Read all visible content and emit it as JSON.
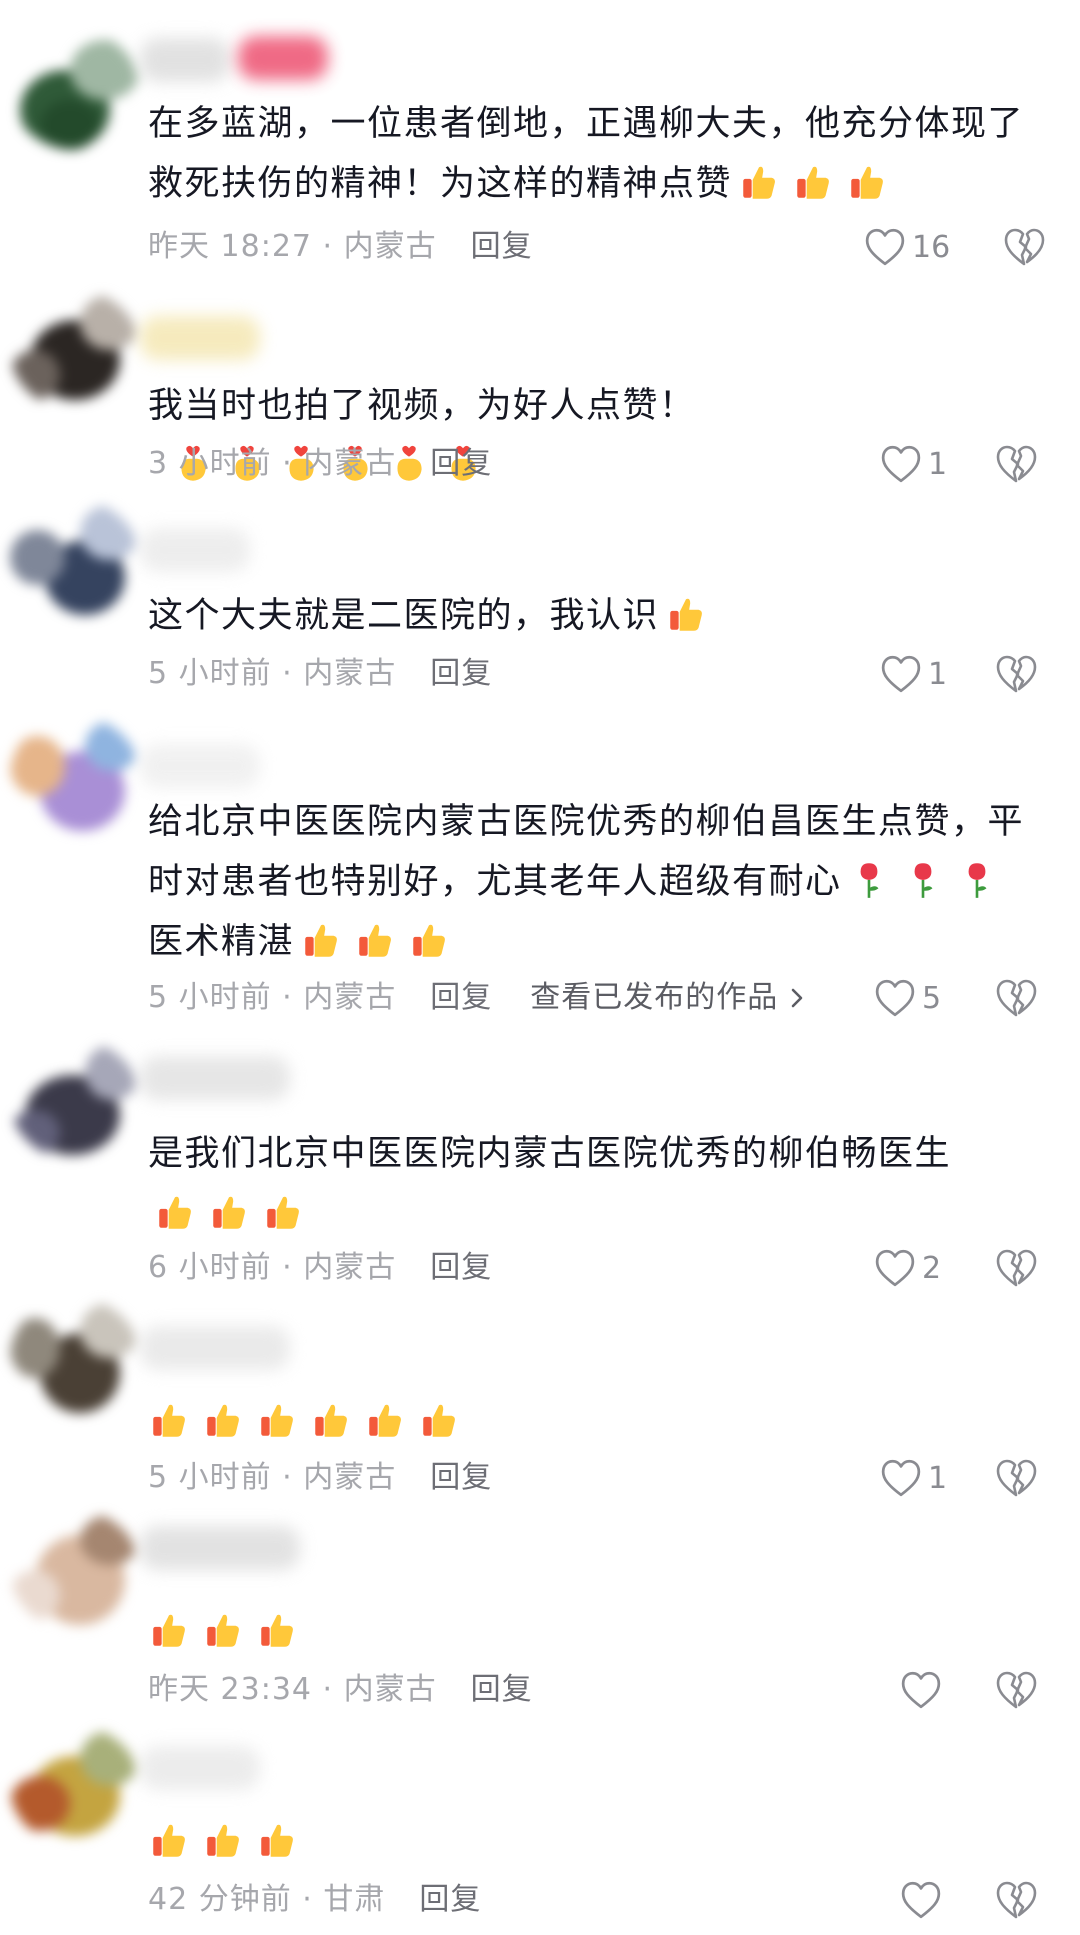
{
  "comments": [
    {
      "text": "在多蓝湖，一位患者倒地，正遇柳大夫，他充分体现了救死扶伤的精神！为这样的精神点赞",
      "emoji": [
        "thumbs-up-icon",
        "thumbs-up-icon",
        "thumbs-up-icon"
      ],
      "time": "昨天 18:27 · 内蒙古",
      "reply": "回复",
      "likes": "16"
    },
    {
      "text": "我当时也拍了视频，为好人点赞！",
      "emoji": [
        "finger-heart-icon",
        "finger-heart-icon",
        "finger-heart-icon",
        "finger-heart-icon",
        "finger-heart-icon",
        "finger-heart-icon"
      ],
      "time": "3 小时前 · 内蒙古",
      "reply": "回复",
      "likes": "1"
    },
    {
      "text": "这个大夫就是二医院的，我认识",
      "emoji": [
        "thumbs-up-icon"
      ],
      "time": "5 小时前 · 内蒙古",
      "reply": "回复",
      "likes": "1"
    },
    {
      "text_a": "给北京中医医院内蒙古医院优秀的柳伯昌医生点赞，平时对患者也特别好，尤其老年人超级有耐心",
      "emoji_a": [
        "rose-icon",
        "rose-icon",
        "rose-icon"
      ],
      "text_b": "医术精湛",
      "emoji_b": [
        "thumbs-up-icon",
        "thumbs-up-icon",
        "thumbs-up-icon"
      ],
      "time": "5 小时前 · 内蒙古",
      "reply": "回复",
      "works_link": "查看已发布的作品",
      "likes": "5"
    },
    {
      "text": "是我们北京中医医院内蒙古医院优秀的柳伯畅医生",
      "emoji": [
        "thumbs-up-icon",
        "thumbs-up-icon",
        "thumbs-up-icon"
      ],
      "time": "6 小时前 · 内蒙古",
      "reply": "回复",
      "likes": "2"
    },
    {
      "emoji": [
        "thumbs-up-icon",
        "thumbs-up-icon",
        "thumbs-up-icon",
        "thumbs-up-icon",
        "thumbs-up-icon",
        "thumbs-up-icon"
      ],
      "time": "5 小时前 · 内蒙古",
      "reply": "回复",
      "likes": "1"
    },
    {
      "emoji": [
        "thumbs-up-icon",
        "thumbs-up-icon",
        "thumbs-up-icon"
      ],
      "time": "昨天 23:34 · 内蒙古",
      "reply": "回复",
      "likes": ""
    },
    {
      "emoji": [
        "thumbs-up-icon",
        "thumbs-up-icon",
        "thumbs-up-icon"
      ],
      "time": "42 分钟前 · 甘肃",
      "reply": "回复",
      "likes": ""
    }
  ],
  "colors": {
    "text": "#161823",
    "meta": "#a6a7ac",
    "reply": "#6d6e75",
    "icon": "#8a8b91"
  }
}
